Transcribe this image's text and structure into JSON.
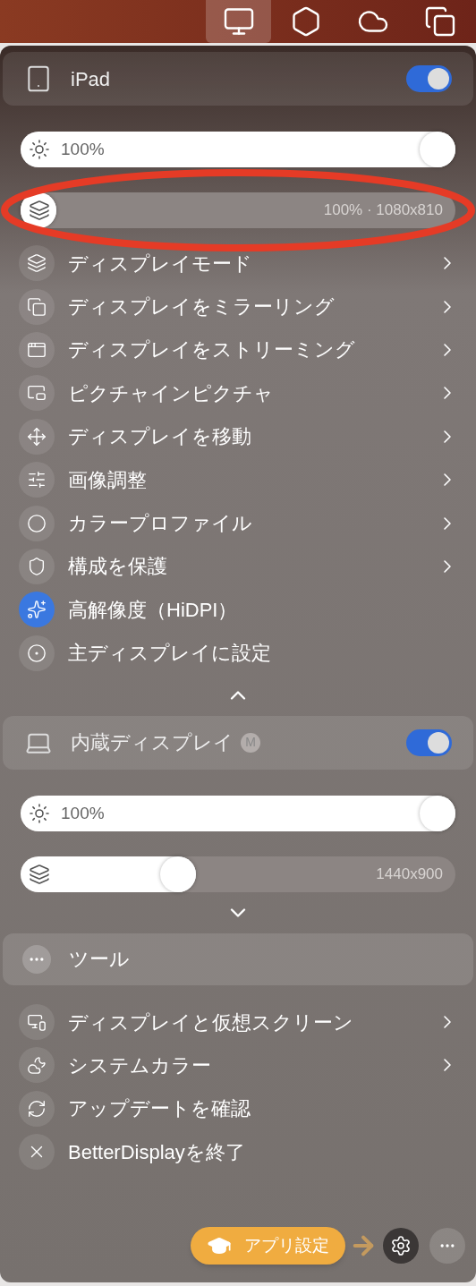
{
  "menu_bar": {
    "icons": [
      {
        "selected": true
      },
      {
        "selected": false
      },
      {
        "selected": false
      },
      {
        "selected": false
      }
    ]
  },
  "displays": [
    {
      "name": "iPad",
      "kind": "tablet",
      "on": true,
      "expanded": true,
      "sliders": [
        {
          "kind": "brightness",
          "level": 1,
          "reading": "100%"
        },
        {
          "kind": "resolution",
          "level": 0,
          "reading": "100% · 1080x810"
        }
      ],
      "menu": [
        {
          "label": "ディスプレイモード",
          "kind": "submenu",
          "active": false
        },
        {
          "label": "ディスプレイをミラーリング",
          "kind": "submenu",
          "active": false
        },
        {
          "label": "ディスプレイをストリーミング",
          "kind": "submenu",
          "active": false
        },
        {
          "label": "ピクチャインピクチャ",
          "kind": "submenu",
          "active": false
        },
        {
          "label": "ディスプレイを移動",
          "kind": "submenu",
          "active": false
        },
        {
          "label": "画像調整",
          "kind": "submenu",
          "active": false
        },
        {
          "label": "カラープロファイル",
          "kind": "submenu",
          "active": false
        },
        {
          "label": "構成を保護",
          "kind": "submenu",
          "active": false
        },
        {
          "label": "高解像度（HiDPI）",
          "kind": "action",
          "active": true
        },
        {
          "label": "主ディスプレイに設定",
          "kind": "action",
          "active": false
        }
      ]
    },
    {
      "name": "内蔵ディスプレイ",
      "kind": "laptop",
      "badge": "M",
      "on": true,
      "expanded": false,
      "sliders": [
        {
          "kind": "brightness",
          "level": 1,
          "reading": "100%"
        },
        {
          "kind": "resolution",
          "level": 0.35,
          "reading": "1440x900"
        }
      ]
    }
  ],
  "tools": {
    "title": "ツール",
    "items": [
      {
        "label": "ディスプレイと仮想スクリーン",
        "kind": "submenu"
      },
      {
        "label": "システムカラー",
        "kind": "submenu"
      },
      {
        "label": "アップデートを確認",
        "kind": "action"
      },
      {
        "label": "BetterDisplayを終了",
        "kind": "action"
      }
    ]
  },
  "footer": {
    "settings_button": "アプリ設定"
  }
}
